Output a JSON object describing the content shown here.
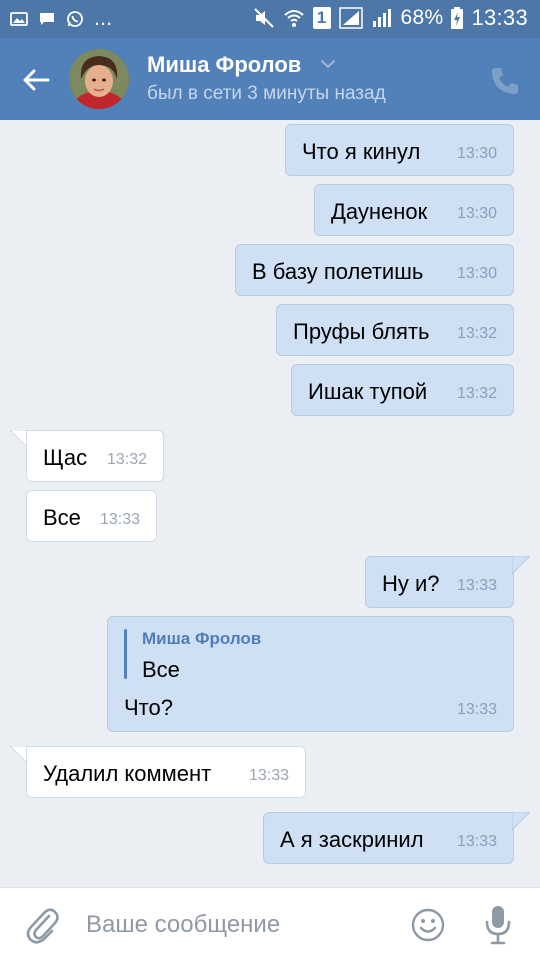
{
  "status_bar": {
    "battery": "68%",
    "time": "13:33",
    "sim": "1",
    "more": "..."
  },
  "header": {
    "name": "Миша Фролов",
    "status": "был в сети 3 минуты назад"
  },
  "messages": [
    {
      "direction": "out",
      "text": "Что я  кинул",
      "time": "13:30"
    },
    {
      "direction": "out",
      "text": "Дауненок",
      "time": "13:30"
    },
    {
      "direction": "out",
      "text": "В базу полетишь",
      "time": "13:30"
    },
    {
      "direction": "out",
      "text": "Пруфы блять",
      "time": "13:32"
    },
    {
      "direction": "out",
      "text": "Ишак тупой",
      "time": "13:32"
    },
    {
      "direction": "in",
      "text": "Щас",
      "time": "13:32"
    },
    {
      "direction": "in",
      "text": "Все",
      "time": "13:33"
    },
    {
      "direction": "out",
      "text": "Ну и?",
      "time": "13:33"
    },
    {
      "direction": "out",
      "reply_author": "Миша Фролов",
      "reply_text": "Все",
      "text": "Что?",
      "time": "13:33"
    },
    {
      "direction": "in",
      "text": "Удалил коммент",
      "time": "13:33"
    },
    {
      "direction": "out",
      "text": "А я заскринил",
      "time": "13:33"
    }
  ],
  "input": {
    "placeholder": "Ваше сообщение"
  },
  "colors": {
    "header": "#5181b8",
    "status_bar": "#4d77a8",
    "outgoing_bubble": "#cfe0f5",
    "incoming_bubble": "#ffffff",
    "chat_background": "#ebeff4"
  },
  "icons": [
    "image-icon",
    "message-icon",
    "whatsapp-icon",
    "mute-icon",
    "wifi-icon",
    "signal-icon",
    "battery-icon",
    "back-arrow-icon",
    "chevron-down-icon",
    "phone-icon",
    "attach-icon",
    "emoji-icon",
    "mic-icon"
  ]
}
